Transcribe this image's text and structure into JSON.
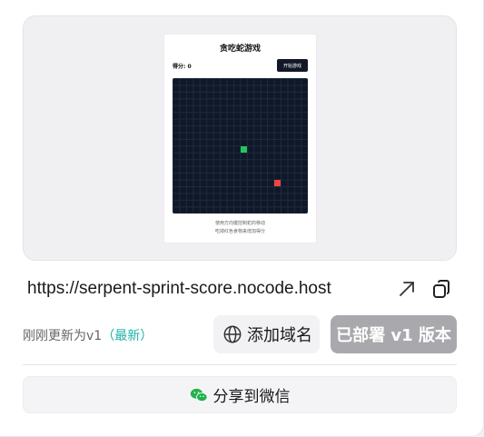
{
  "preview": {
    "game_title": "贪吃蛇游戏",
    "score_label": "得分: 0",
    "start_button": "开始游戏",
    "help_line1": "使用方向键控制蛇的移动",
    "help_line2": "吃掉红色食物来增加得分",
    "snake_color": "#22c55e",
    "food_color": "#ef4444",
    "board_color": "#0f1828"
  },
  "url": "https://serpent-sprint-score.nocode.host",
  "icons": {
    "open": "external-link-icon",
    "copy": "copy-icon",
    "globe": "globe-icon",
    "wechat": "wechat-icon"
  },
  "status": {
    "text": "刚刚更新为v1",
    "latest": "（最新）",
    "latest_color": "#20b2aa"
  },
  "buttons": {
    "add_domain": "添加域名",
    "deployed": "已部署 v1 版本",
    "share_wechat": "分享到微信"
  }
}
